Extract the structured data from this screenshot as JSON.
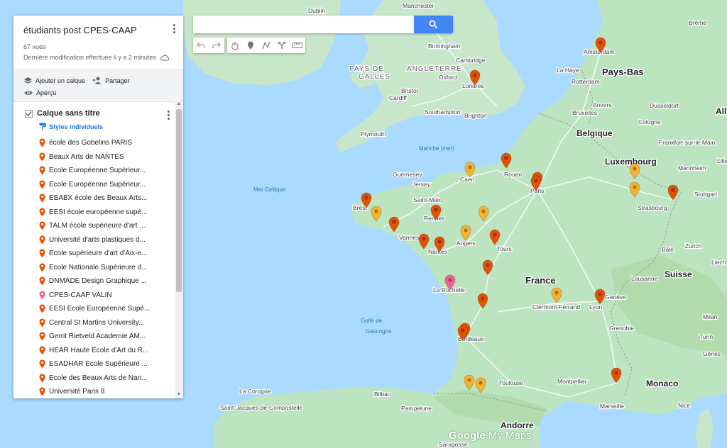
{
  "map_title": "étudiants post CPES-CAAP",
  "views": "67 vues",
  "last_modified": "Dernière modification effectuée il y a 2 minutes",
  "actions": {
    "add_layer": "Ajouter un calque",
    "share": "Partager",
    "preview": "Aperçu"
  },
  "layer": {
    "name": "Calque sans titre",
    "styles": "Styles individuels",
    "items": [
      {
        "label": "école des Gobelins PARIS",
        "color": "#e65100"
      },
      {
        "label": "Beaux Arts de NANTES",
        "color": "#e65100"
      },
      {
        "label": "École Européenne Supérieur...",
        "color": "#e65100"
      },
      {
        "label": "École Européenne Supérieur...",
        "color": "#e65100"
      },
      {
        "label": "EBABX école des Beaux Arts...",
        "color": "#e65100"
      },
      {
        "label": "EESI école européenne supé...",
        "color": "#e65100"
      },
      {
        "label": "TALM école supérieure d'art ...",
        "color": "#e65100"
      },
      {
        "label": "Université d'arts plastiques d...",
        "color": "#e65100"
      },
      {
        "label": "École supérieure d'art d'Aix-e...",
        "color": "#e65100"
      },
      {
        "label": "École Nationale Supérieure d...",
        "color": "#e65100"
      },
      {
        "label": "DNMADE Design Graphique ...",
        "color": "#e65100"
      },
      {
        "label": "CPES-CAAP VALIN",
        "color": "#f06292"
      },
      {
        "label": "EESI École Européenne Supé...",
        "color": "#e65100"
      },
      {
        "label": "Central St Martins University...",
        "color": "#e65100"
      },
      {
        "label": "Gerrit Rietveld Academie AM...",
        "color": "#e65100"
      },
      {
        "label": "HEAR Haute École d'Art du R...",
        "color": "#e65100"
      },
      {
        "label": "ESADHAR Ecole Supérieure ...",
        "color": "#e65100"
      },
      {
        "label": "Ecole des Beaux Arts de Nan...",
        "color": "#e65100"
      },
      {
        "label": "Université Paris 8",
        "color": "#e65100"
      }
    ]
  },
  "search": {
    "placeholder": "",
    "value": ""
  },
  "logo": {
    "brand": "Google",
    "product": "My Maps"
  },
  "map_labels": {
    "countries": [
      {
        "text": "Pays-Bas"
      },
      {
        "text": "Belgique"
      },
      {
        "text": "Luxembourg"
      },
      {
        "text": "France"
      },
      {
        "text": "Suisse"
      },
      {
        "text": "Monaco"
      },
      {
        "text": "Andorre"
      },
      {
        "text": "All"
      }
    ],
    "regions": [
      {
        "text": "PAYS DE"
      },
      {
        "text": "GALLES"
      },
      {
        "text": "ANGLETERRE"
      }
    ],
    "seas": [
      {
        "text": "Mer Celtique"
      },
      {
        "text": "Manche (mer)"
      },
      {
        "text": "Golfe de"
      },
      {
        "text": "Gascogne"
      }
    ],
    "cities": [
      {
        "text": "Dublin"
      },
      {
        "text": "Manchester"
      },
      {
        "text": "Birmingham"
      },
      {
        "text": "Cambridge"
      },
      {
        "text": "Oxford"
      },
      {
        "text": "Londres"
      },
      {
        "text": "Bristol"
      },
      {
        "text": "Cardiff"
      },
      {
        "text": "Southampton"
      },
      {
        "text": "Brighton"
      },
      {
        "text": "Plymouth"
      },
      {
        "text": "Guernesey"
      },
      {
        "text": "Jersey"
      },
      {
        "text": "Saint-Malo"
      },
      {
        "text": "Brest"
      },
      {
        "text": "Rennes"
      },
      {
        "text": "Vannes"
      },
      {
        "text": "Nantes"
      },
      {
        "text": "Angers"
      },
      {
        "text": "Tours"
      },
      {
        "text": "Rouen"
      },
      {
        "text": "Paris"
      },
      {
        "text": "Caen"
      },
      {
        "text": "La Rochelle"
      },
      {
        "text": "Bordeaux"
      },
      {
        "text": "Toulouse"
      },
      {
        "text": "Montpellier"
      },
      {
        "text": "Marseille"
      },
      {
        "text": "Lyon"
      },
      {
        "text": "Clermont-Ferrand"
      },
      {
        "text": "Genève"
      },
      {
        "text": "Grenoble"
      },
      {
        "text": "Strasbourg"
      },
      {
        "text": "Amsterdam"
      },
      {
        "text": "La Haye"
      },
      {
        "text": "Rotterdam"
      },
      {
        "text": "Anvers"
      },
      {
        "text": "Bruxelles"
      },
      {
        "text": "Cologne"
      },
      {
        "text": "Düsseldorf"
      },
      {
        "text": "Brême"
      },
      {
        "text": "Frankfort-sur-le-Main"
      },
      {
        "text": "Mannheim"
      },
      {
        "text": "Stuttgart"
      },
      {
        "text": "Lausanne"
      },
      {
        "text": "Bâle"
      },
      {
        "text": "Zurich"
      },
      {
        "text": "Milan"
      },
      {
        "text": "Turin"
      },
      {
        "text": "Gênes"
      },
      {
        "text": "Bilbao"
      },
      {
        "text": "La Corogne"
      },
      {
        "text": "Saint-Jacques-de-Compostelle"
      },
      {
        "text": "Pampelune"
      },
      {
        "text": "Saragosse"
      },
      {
        "text": "Nice"
      },
      {
        "text": "Lille"
      },
      {
        "text": "Liech"
      }
    ]
  }
}
